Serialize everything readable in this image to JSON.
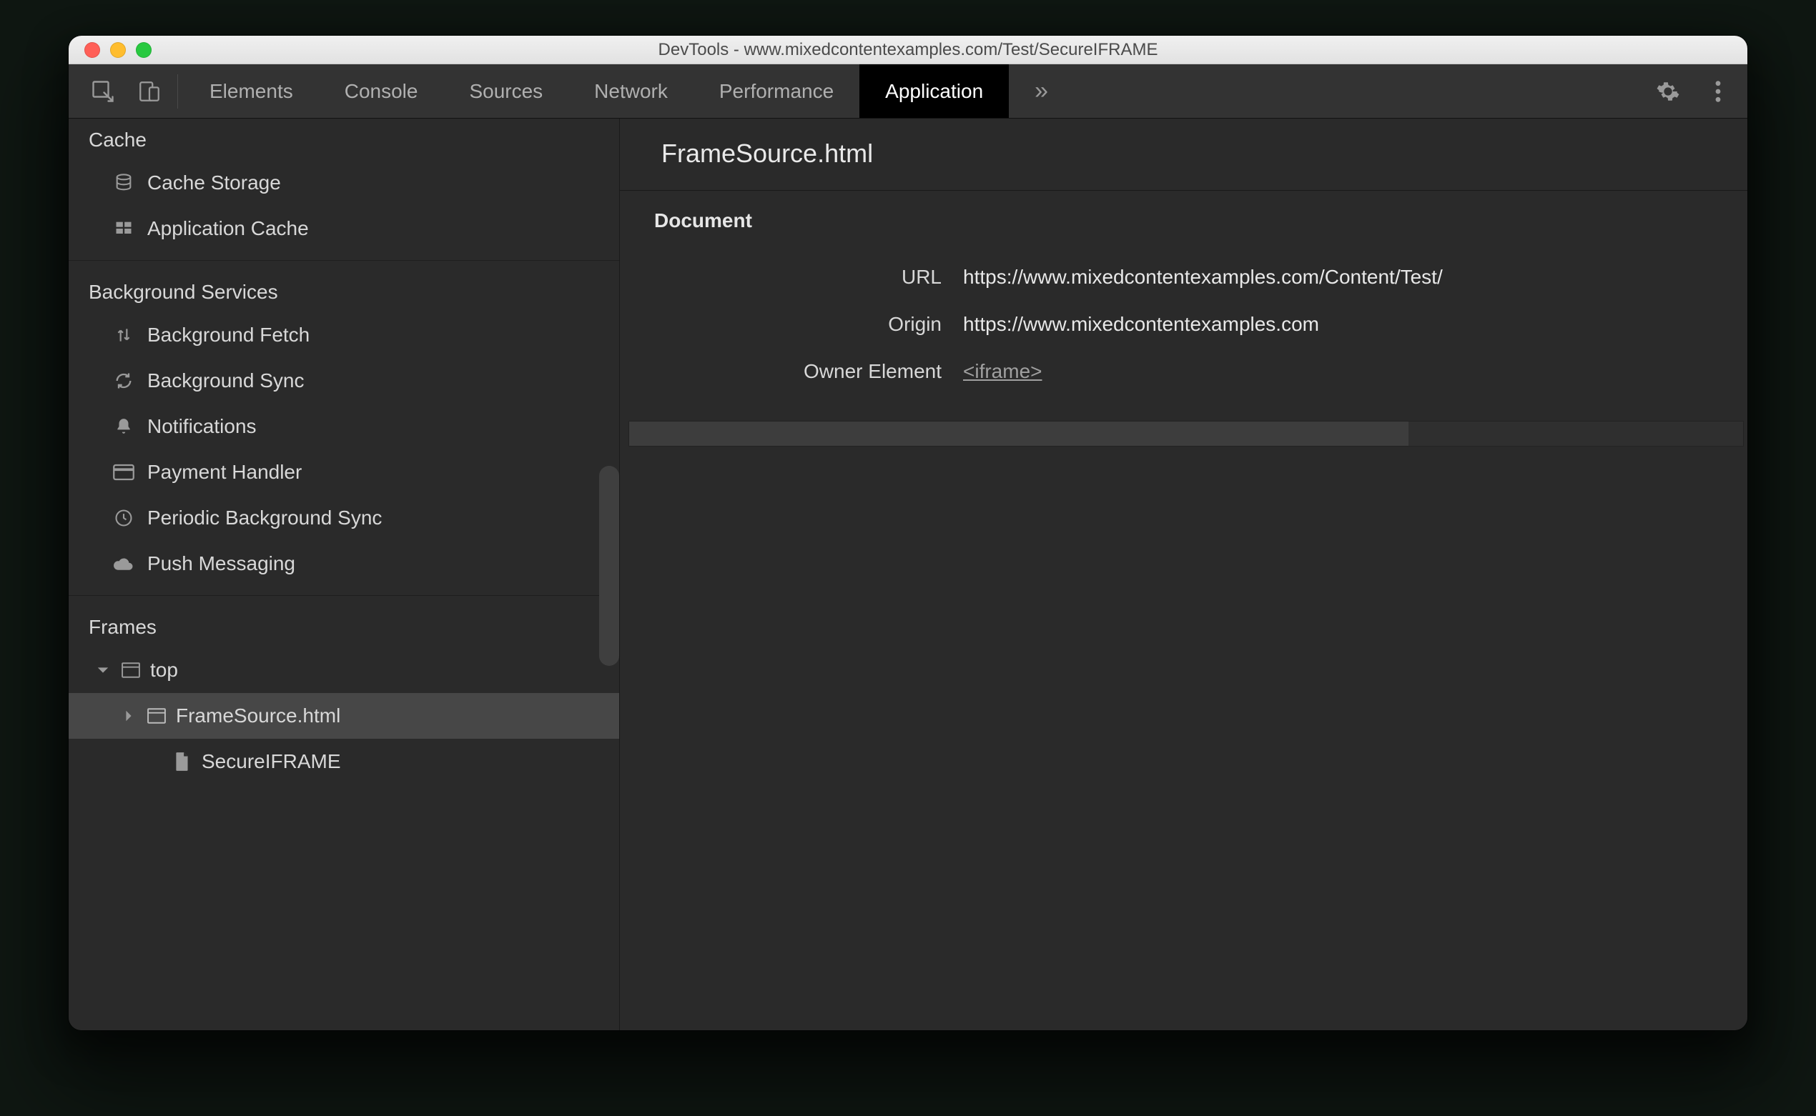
{
  "window_title": "DevTools - www.mixedcontentexamples.com/Test/SecureIFRAME",
  "tabs": {
    "items": [
      "Elements",
      "Console",
      "Sources",
      "Network",
      "Performance",
      "Application"
    ],
    "active_index": 5,
    "overflow_glyph": "»"
  },
  "sidebar": {
    "sections": {
      "cache": {
        "title": "Cache",
        "items": [
          "Cache Storage",
          "Application Cache"
        ]
      },
      "background_services": {
        "title": "Background Services",
        "items": [
          "Background Fetch",
          "Background Sync",
          "Notifications",
          "Payment Handler",
          "Periodic Background Sync",
          "Push Messaging"
        ]
      },
      "frames": {
        "title": "Frames",
        "tree": {
          "top": {
            "label": "top",
            "expanded": true
          },
          "child1": {
            "label": "FrameSource.html",
            "expanded": false,
            "selected": true
          },
          "child2": {
            "label": "SecureIFRAME"
          }
        }
      }
    }
  },
  "main": {
    "title": "FrameSource.html",
    "section_label": "Document",
    "rows": {
      "url": {
        "label": "URL",
        "value": "https://www.mixedcontentexamples.com/Content/Test/"
      },
      "origin": {
        "label": "Origin",
        "value": "https://www.mixedcontentexamples.com"
      },
      "owner_element": {
        "label": "Owner Element",
        "value": "<iframe>"
      }
    }
  }
}
